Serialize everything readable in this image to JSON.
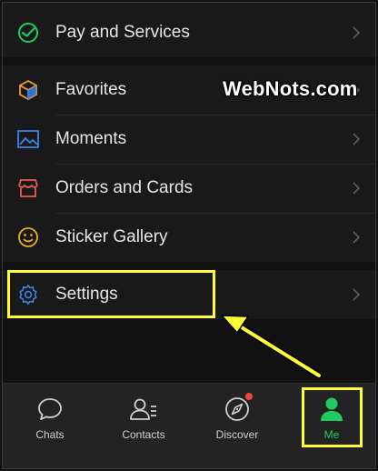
{
  "menu": {
    "pay": {
      "label": "Pay and Services",
      "icon": "pay-check-icon"
    },
    "items": [
      {
        "label": "Favorites",
        "icon": "cube-icon"
      },
      {
        "label": "Moments",
        "icon": "image-icon"
      },
      {
        "label": "Orders and Cards",
        "icon": "shop-icon"
      },
      {
        "label": "Sticker Gallery",
        "icon": "smiley-icon"
      }
    ],
    "settings": {
      "label": "Settings",
      "icon": "gear-icon"
    }
  },
  "watermark": "WebNots.com",
  "tabs": [
    {
      "label": "Chats",
      "icon": "chat-bubble-icon"
    },
    {
      "label": "Contacts",
      "icon": "contacts-icon"
    },
    {
      "label": "Discover",
      "icon": "compass-icon"
    },
    {
      "label": "Me",
      "icon": "person-icon"
    }
  ],
  "colors": {
    "accent": "#1fcb5f",
    "highlight": "#ffff33",
    "badge": "#f0443a",
    "background": "#111111",
    "row": "#191919"
  }
}
